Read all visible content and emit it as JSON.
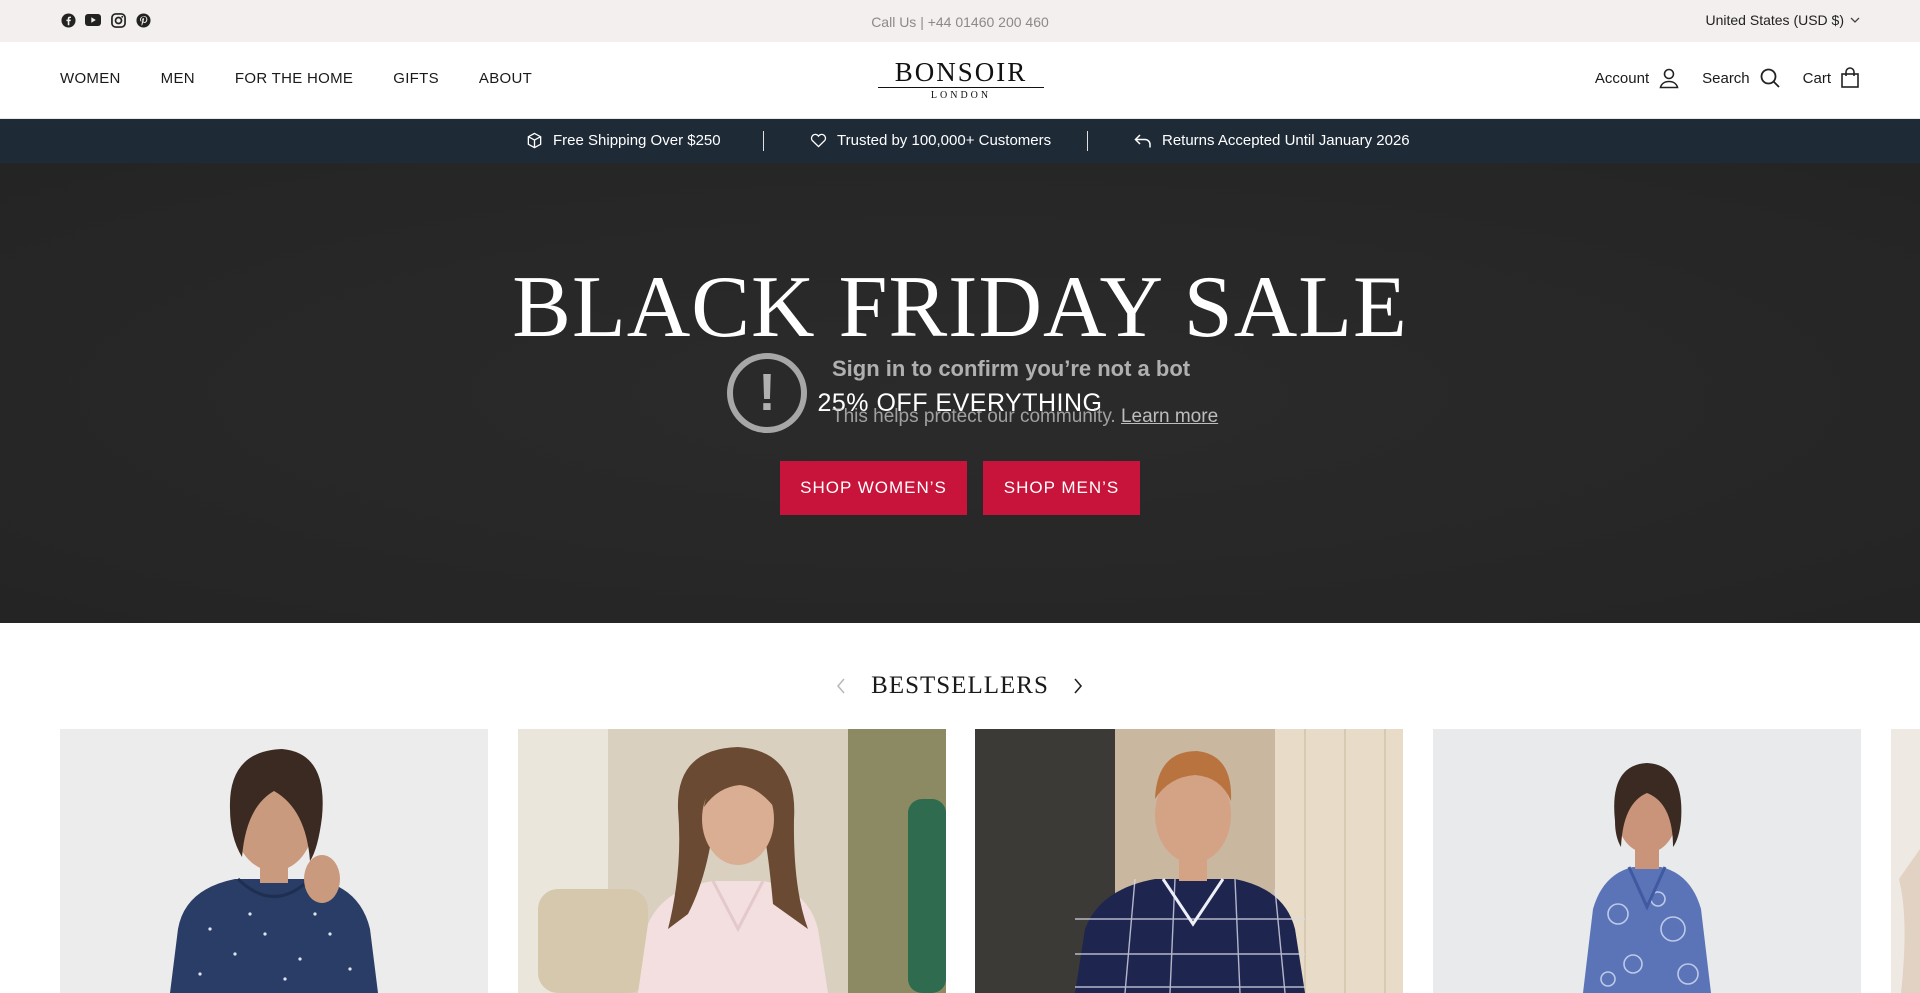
{
  "topbar": {
    "social": [
      "facebook-icon",
      "youtube-icon",
      "instagram-icon",
      "pinterest-icon"
    ],
    "call_us": "Call Us | +44 01460 200 460",
    "country": "United States (USD $)"
  },
  "header": {
    "nav": [
      "WOMEN",
      "MEN",
      "FOR THE HOME",
      "GIFTS",
      "ABOUT"
    ],
    "logo_main": "BONSOIR",
    "logo_sub": "LONDON",
    "account": "Account",
    "search": "Search",
    "cart": "Cart"
  },
  "announcement": {
    "items": [
      "Free Shipping Over $250",
      "Trusted by 100,000+ Customers",
      "Returns Accepted Until January 2026"
    ]
  },
  "hero": {
    "title": "BLACK FRIDAY SALE",
    "subtitle": "25% OFF EVERYTHING",
    "overlay_title": "Sign in to confirm you’re not a bot",
    "overlay_text": "This helps protect our community.",
    "overlay_link": "Learn more",
    "btn_women": "SHOP WOMEN’S",
    "btn_men": "SHOP MEN’S"
  },
  "bestsellers": {
    "title": "BESTSELLERS"
  },
  "colors": {
    "topbar_bg": "#f3efee",
    "announce_bg": "#1f2a37",
    "hero_bg": "#2a2a2a",
    "button_red": "#c8143b"
  }
}
